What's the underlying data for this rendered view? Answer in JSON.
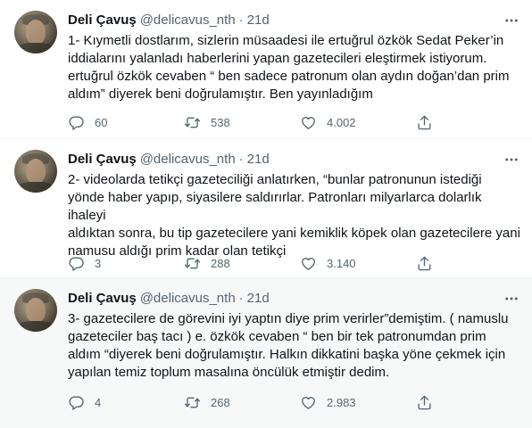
{
  "tweets": [
    {
      "author_name": "Deli Çavuş",
      "author_handle": "@delicavus_nth",
      "separator": "·",
      "time": "21d",
      "text": "1- Kıymetli dostlarım, sizlerin müsaadesi ile ertuğrul özkök Sedat Peker’in\niddialarını yalanladı haberlerini  yapan gazetecileri eleştirmek istiyorum.\nertuğrul özkök cevaben “ ben sadece patronum olan aydın doğan’dan prim\naldım” diyerek beni doğrulamıştır. Ben yayınladığım",
      "replies": "60",
      "retweets": "538",
      "likes": "4.002"
    },
    {
      "author_name": "Deli Çavuş",
      "author_handle": "@delicavus_nth",
      "separator": "·",
      "time": "21d",
      "text": "2- videolarda tetikçi gazeteciliği anlatırken, “bunlar patronunun istediği\nyönde haber yapıp, siyasilere saldırırlar. Patronları milyarlarca dolarlık ihaleyi\naldıktan sonra, bu tip gazetecilere yani kemiklik köpek olan gazetecilere yani\nnamusu aldığı prim kadar olan tetikçi",
      "replies": "3",
      "retweets": "288",
      "likes": "3.140"
    },
    {
      "author_name": "Deli Çavuş",
      "author_handle": "@delicavus_nth",
      "separator": "·",
      "time": "21d",
      "text": "3- gazetecilere de görevini iyi yaptın diye prim verirler”demiştim. ( namuslu\ngazeteciler baş tacı ) e. özkök cevaben “ ben bir tek patronumdan prim\naldım “diyerek beni doğrulamıştır. Halkın dikkatini başka yöne çekmek için\nyapılan temiz toplum masalına öncülük etmiştir dedim.",
      "replies": "4",
      "retweets": "268",
      "likes": "2.983"
    }
  ],
  "icons": [
    "more-icon",
    "reply-icon",
    "retweet-icon",
    "like-icon",
    "share-icon"
  ],
  "colors": {
    "text": "#0f1419",
    "secondary": "#536471",
    "hover_bg": "#f7f9f9",
    "divider": "#eff3f4"
  }
}
